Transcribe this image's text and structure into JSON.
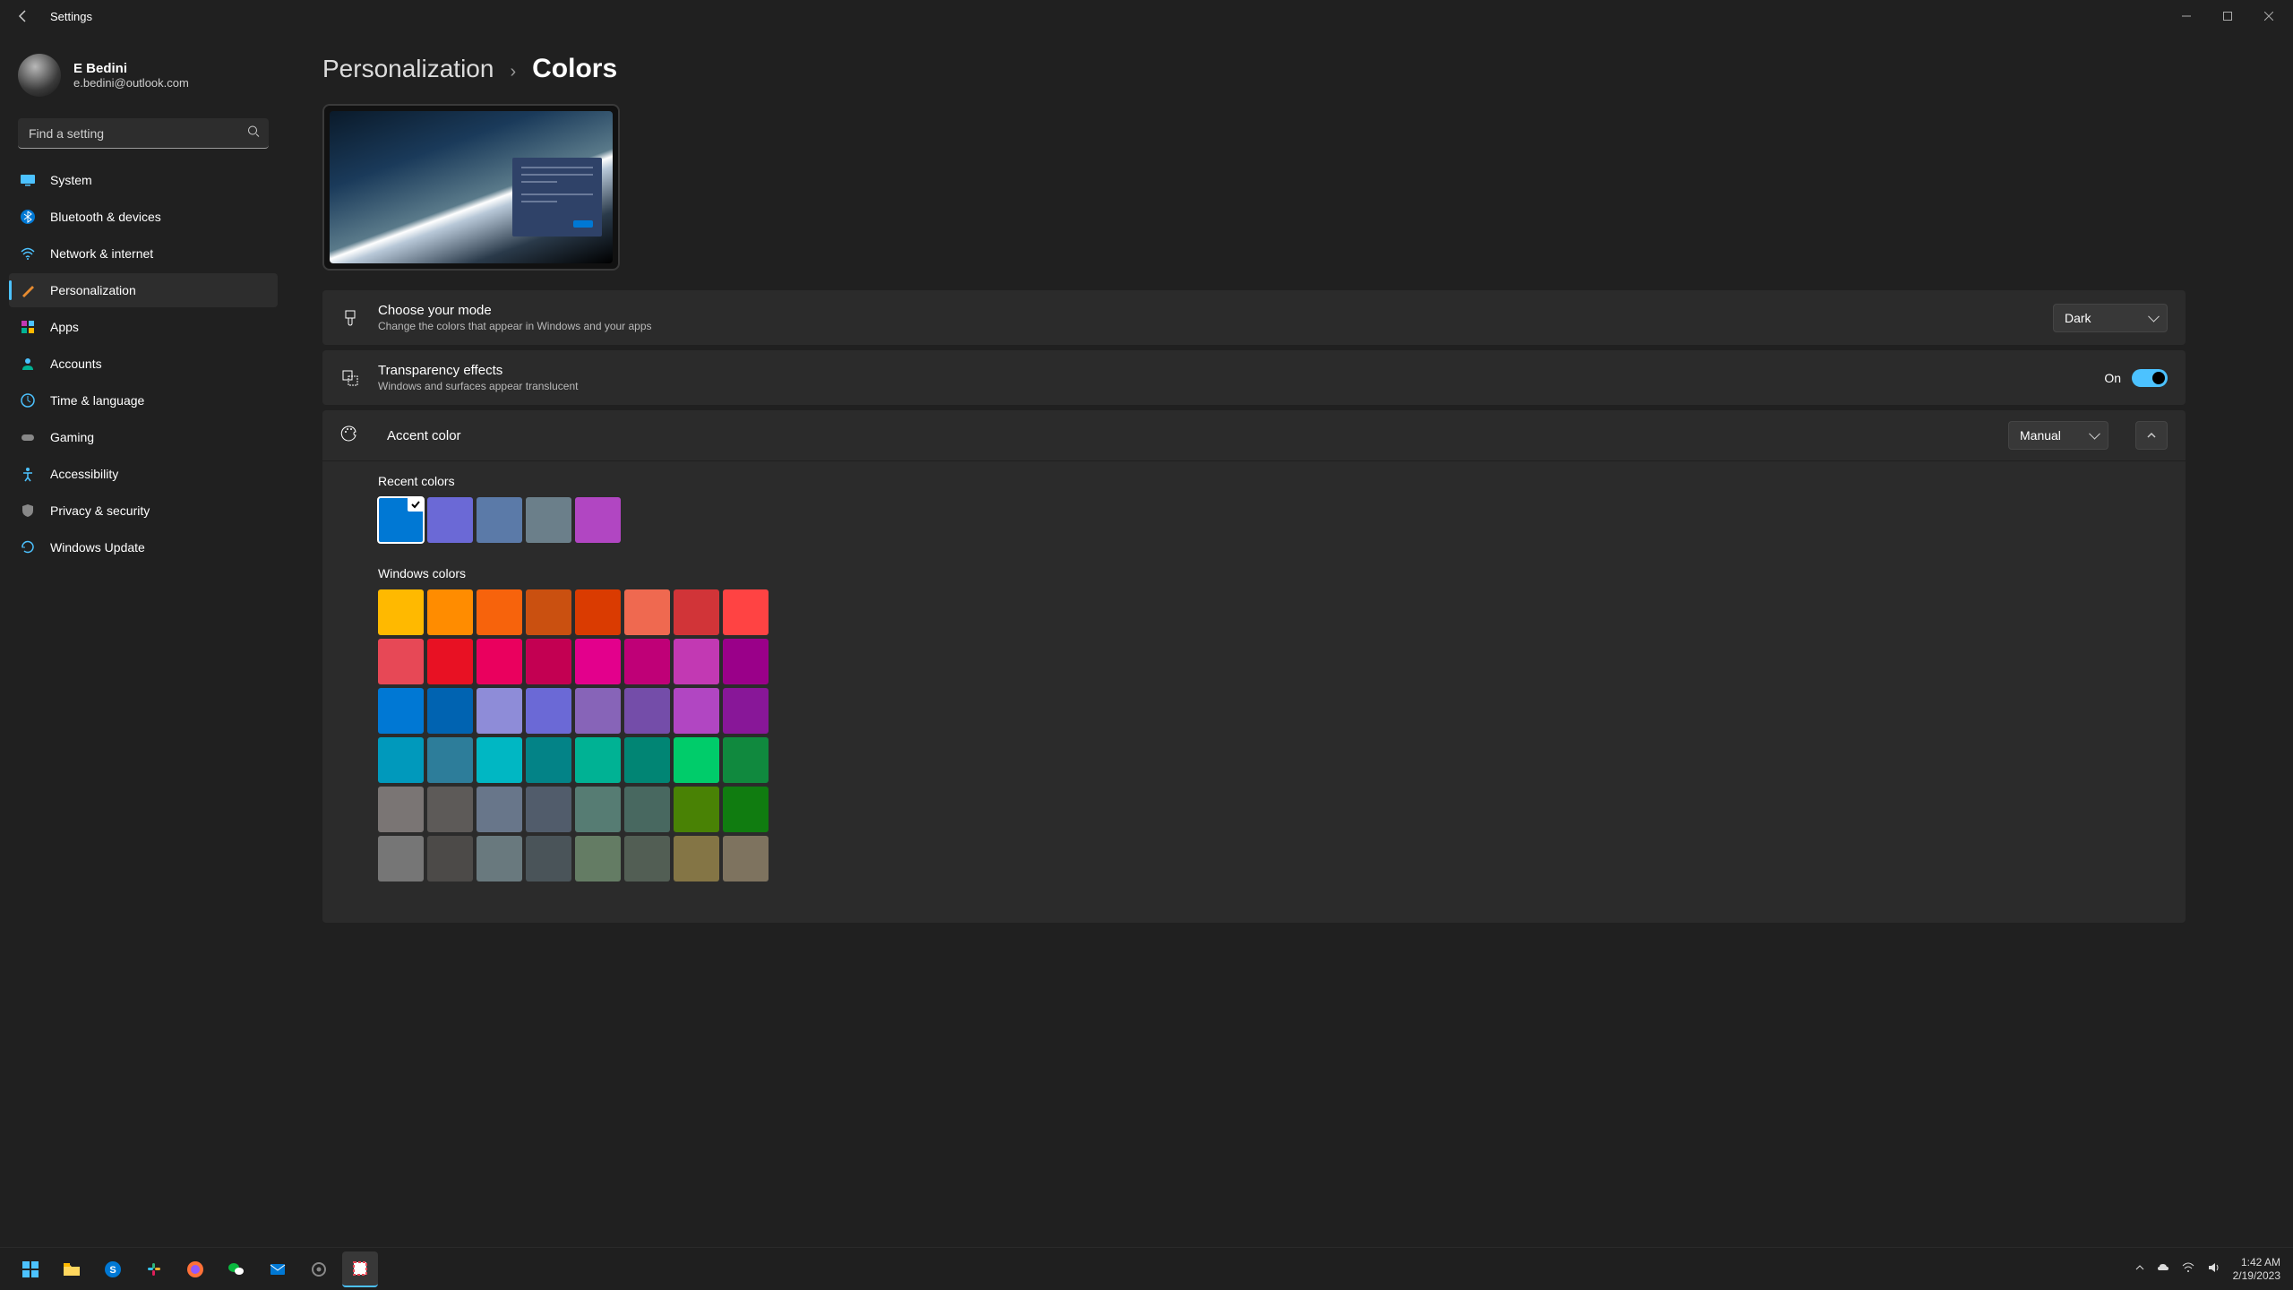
{
  "window": {
    "title": "Settings"
  },
  "user": {
    "name": "E       Bedini",
    "email": "e.bedini@outlook.com"
  },
  "search": {
    "placeholder": "Find a setting"
  },
  "nav": {
    "items": [
      {
        "label": "System"
      },
      {
        "label": "Bluetooth & devices"
      },
      {
        "label": "Network & internet"
      },
      {
        "label": "Personalization"
      },
      {
        "label": "Apps"
      },
      {
        "label": "Accounts"
      },
      {
        "label": "Time & language"
      },
      {
        "label": "Gaming"
      },
      {
        "label": "Accessibility"
      },
      {
        "label": "Privacy & security"
      },
      {
        "label": "Windows Update"
      }
    ],
    "active_index": 3
  },
  "breadcrumb": {
    "parent": "Personalization",
    "current": "Colors"
  },
  "mode": {
    "title": "Choose your mode",
    "desc": "Change the colors that appear in Windows and your apps",
    "value": "Dark"
  },
  "transparency": {
    "title": "Transparency effects",
    "desc": "Windows and surfaces appear translucent",
    "state_label": "On",
    "on": true
  },
  "accent": {
    "title": "Accent color",
    "mode_value": "Manual",
    "recent_label": "Recent colors",
    "recent": [
      "#0078d4",
      "#6b69d6",
      "#5b7aa8",
      "#6b7f8a",
      "#b146c2"
    ],
    "recent_selected_index": 0,
    "windows_label": "Windows colors",
    "windows": [
      "#ffb900",
      "#ff8c00",
      "#f7630c",
      "#ca5010",
      "#da3b01",
      "#ef6950",
      "#d13438",
      "#ff4343",
      "#e74856",
      "#e81123",
      "#ea005e",
      "#c30052",
      "#e3008c",
      "#bf0077",
      "#c239b3",
      "#9a0089",
      "#0078d4",
      "#0063b1",
      "#8e8cd8",
      "#6b69d6",
      "#8764b8",
      "#744da9",
      "#b146c2",
      "#881798",
      "#0099bc",
      "#2d7d9a",
      "#00b7c3",
      "#038387",
      "#00b294",
      "#018574",
      "#00cc6a",
      "#10893e",
      "#7a7574",
      "#5d5a58",
      "#68768a",
      "#515c6b",
      "#567c73",
      "#486860",
      "#498205",
      "#107c10",
      "#767676",
      "#4c4a48",
      "#69797e",
      "#4a5459",
      "#647c64",
      "#525e54",
      "#847545",
      "#7e735f"
    ]
  },
  "taskbar": {
    "time": "1:42 AM",
    "date": "2/19/2023"
  }
}
